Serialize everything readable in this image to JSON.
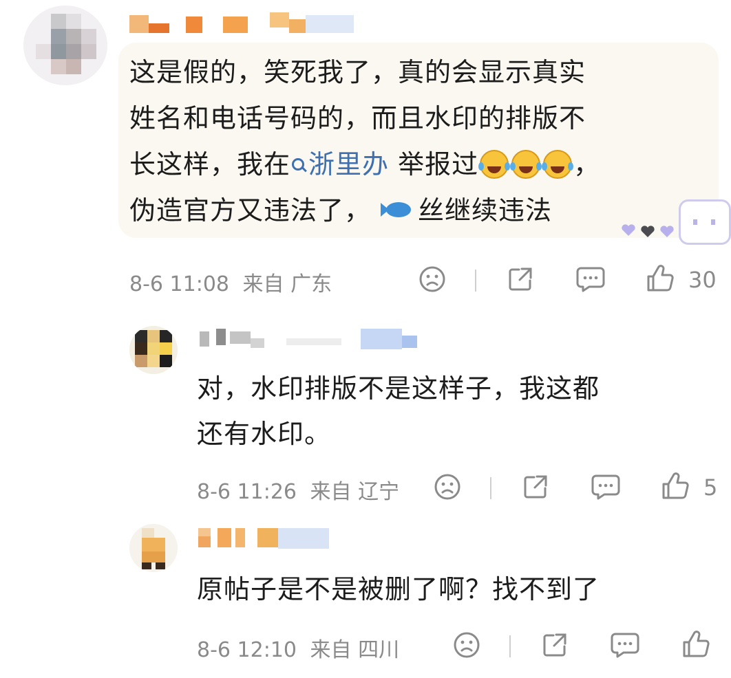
{
  "comments": [
    {
      "text_lines": [
        "这是假的，笑死我了，真的会显示真实",
        "姓名和电话号码的，而且水印的排版不"
      ],
      "line3_before": "长这样，我在",
      "topic": "浙里办",
      "line3_after": "举报过",
      "line4_before": "伪造官方又违法了，",
      "line4_after": "丝继续违法",
      "time": "8-6 11:08",
      "from": "来自 广东",
      "likes": "30",
      "emoji_count": 3
    },
    {
      "text_lines": [
        "对，水印排版不是这样子，我这都",
        "还有水印。"
      ],
      "time": "8-6 11:26",
      "from": "来自 辽宁",
      "likes": "5"
    },
    {
      "text_lines": [
        "原帖子是不是被删了啊？找不到了"
      ],
      "time": "8-6 12:10",
      "from": "来自 四川",
      "likes": ""
    }
  ],
  "icons": [
    "dislike-face-icon",
    "share-icon",
    "comment-icon",
    "thumbs-up-icon"
  ],
  "colors": {
    "topic": "#3d6fb1",
    "meta": "#8a8a8a",
    "bubble": "#fbf8f1"
  }
}
